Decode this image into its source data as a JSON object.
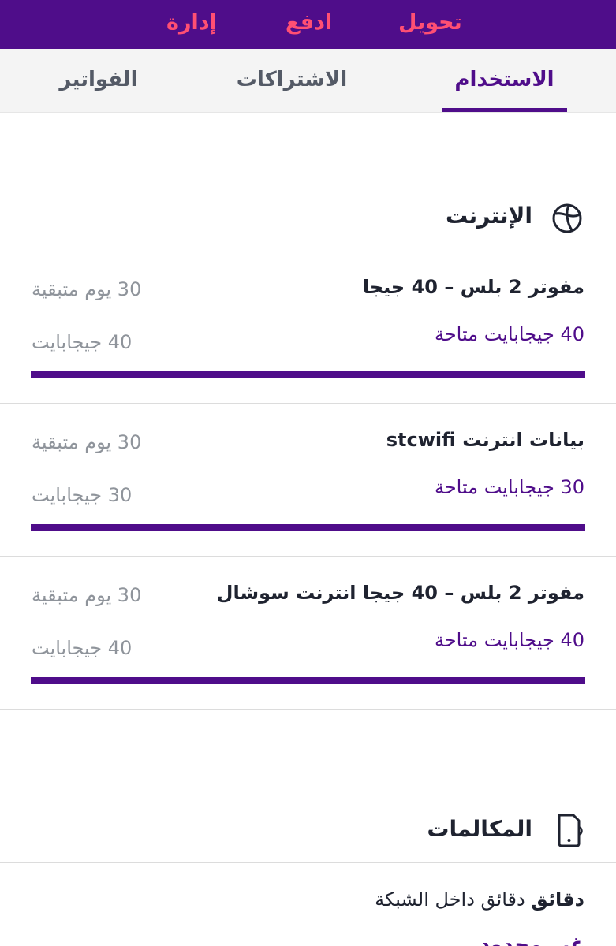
{
  "header": {
    "actions": [
      {
        "label": "تحويل"
      },
      {
        "label": "ادفع"
      },
      {
        "label": "إدارة"
      }
    ]
  },
  "tabs": [
    {
      "label": "الاستخدام",
      "active": true
    },
    {
      "label": "الاشتراكات",
      "active": false
    },
    {
      "label": "الفواتير",
      "active": false
    }
  ],
  "internet": {
    "title": "الإنترنت",
    "icon": "globe-icon",
    "bundles": [
      {
        "name": "مفوتر 2 بلس – 40 جيجا",
        "available": "40 جيجابايت متاحة",
        "days_left": "30 يوم متبقية",
        "total": "40 جيجابايت",
        "remaining_fraction": 1.0
      },
      {
        "name": "بيانات انترنت stcwifi",
        "available": "30 جيجابايت متاحة",
        "days_left": "30 يوم متبقية",
        "total": "30 جيجابايت",
        "remaining_fraction": 1.0
      },
      {
        "name": "مفوتر 2 بلس – 40 جيجا انترنت سوشال",
        "available": "40 جيجابايت متاحة",
        "days_left": "30 يوم متبقية",
        "total": "40 جيجابايت",
        "remaining_fraction": 1.0
      }
    ]
  },
  "calls": {
    "title": "المكالمات",
    "icon": "phone-icon",
    "minutes_bold": "دقائق",
    "minutes_desc": "دقائق داخل الشبكة",
    "value": "غير محدود"
  },
  "colors": {
    "brand": "#4f0d8a",
    "accent": "#ff4f73",
    "muted": "#8f949b"
  }
}
